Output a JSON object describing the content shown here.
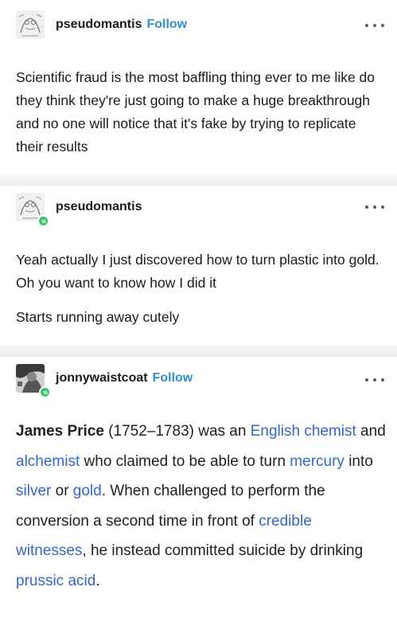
{
  "posts": [
    {
      "username": "pseudomantis",
      "follow_label": "Follow",
      "avatar_icon": "doodle-avatar-icon",
      "paragraphs": [
        "Scientific fraud is the most baffling thing ever to me like  do they think they're just going to make a huge breakthrough and no one will notice that it's fake by trying to replicate their results"
      ]
    },
    {
      "username": "pseudomantis",
      "avatar_icon": "doodle-avatar-icon",
      "badge_icon": "reblog-badge-icon",
      "paragraphs": [
        "Yeah actually I just discovered how to turn plastic into gold. Oh you want to know how I did it",
        "Starts  running away cutely"
      ]
    },
    {
      "username": "jonnywaistcoat",
      "follow_label": "Follow",
      "avatar_icon": "photo-avatar-icon",
      "badge_icon": "reblog-badge-icon"
    }
  ],
  "wiki": {
    "name": "James Price",
    "t1": " (1752–1783) was an ",
    "link_english_chemist": "English chemist",
    "t2": " and ",
    "link_alchemist": "alchemist",
    "t3": " who claimed to be able to turn ",
    "link_mercury": "mercury",
    "t4": " into ",
    "link_silver": "silver",
    "t5": " or ",
    "link_gold": "gold",
    "t6": ". When challenged to perform the conversion a second time in front of ",
    "link_credible_witnesses": "credible witnesses",
    "t7": ", he instead committed suicide by drinking ",
    "link_prussic_acid": "prussic acid",
    "t8": "."
  },
  "colors": {
    "follow": "#2f8fd6",
    "link": "#3366cc",
    "badge": "#35c46b",
    "separator": "#ededed"
  }
}
